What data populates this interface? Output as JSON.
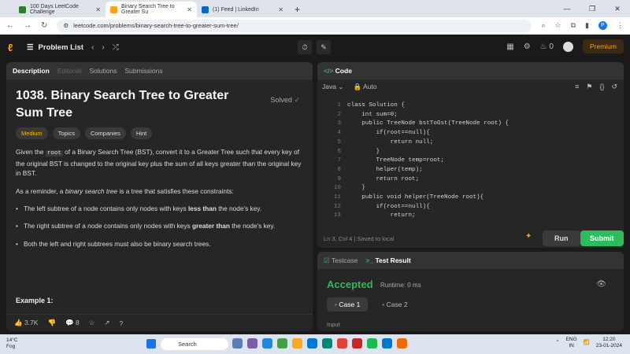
{
  "browser": {
    "tabs": [
      {
        "label": "100 Days LeetCode Challenge",
        "fav": "#2e7d32"
      },
      {
        "label": "Binary Search Tree to Greater Su",
        "fav": "#ffa116"
      },
      {
        "label": "(1) Feed | LinkedIn",
        "fav": "#0a66c2"
      }
    ],
    "url": "leetcode.com/problems/binary-search-tree-to-greater-sum-tree/",
    "profile_initial": "P"
  },
  "top": {
    "problem_list": "Problem List",
    "streak": "0",
    "premium": "Premium"
  },
  "left": {
    "tabs": [
      "Description",
      "Editorial",
      "Solutions",
      "Submissions"
    ],
    "title": "1038. Binary Search Tree to Greater Sum Tree",
    "solved": "Solved",
    "chips": [
      "Medium",
      "Topics",
      "Companies",
      "Hint"
    ],
    "p1a": "Given the ",
    "p1code": "root",
    "p1b": " of a Binary Search Tree (BST), convert it to a Greater Tree such that every key of the original BST is changed to the original key plus the sum of all keys greater than the original key in BST.",
    "p2a": "As a reminder, a ",
    "p2em": "binary search tree",
    "p2b": " is a tree that satisfies these constraints:",
    "b1a": "The left subtree of a node contains only nodes with keys ",
    "b1s": "less than",
    "b1b": " the node's key.",
    "b2a": "The right subtree of a node contains only nodes with keys ",
    "b2s": "greater than",
    "b2b": " the node's key.",
    "b3": "Both the left and right subtrees must also be binary search trees.",
    "example": "Example 1:",
    "likes": "3.7K",
    "comments": "8"
  },
  "code": {
    "tab": "Code",
    "lang": "Java",
    "auto": "Auto",
    "status": "Ln 3, Col 4  |  Saved to local",
    "run": "Run",
    "submit": "Submit",
    "lines": [
      "class Solution {",
      "    int sum=0;",
      "    public TreeNode bstToGst(TreeNode root) {",
      "        if(root==null){",
      "            return null;",
      "        }",
      "        TreeNode temp=root;",
      "        helper(temp);",
      "        return root;",
      "    }",
      "    public void helper(TreeNode root){",
      "        if(root==null){",
      "            return;"
    ]
  },
  "result": {
    "tabs": [
      "Testcase",
      "Test Result"
    ],
    "status": "Accepted",
    "runtime": "Runtime: 0 ms",
    "cases": [
      "Case 1",
      "Case 2"
    ],
    "input": "Input"
  },
  "taskbar": {
    "temp": "14°C",
    "weather": "Fog",
    "search": "Search",
    "lang1": "ENG",
    "lang2": "IN",
    "time": "12:20",
    "date": "23-01-2024"
  }
}
